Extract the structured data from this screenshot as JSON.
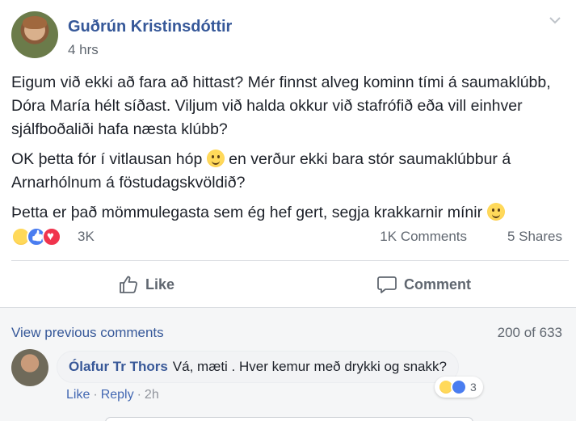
{
  "post": {
    "author": "Guðrún Kristinsdóttir",
    "time": "4 hrs",
    "paragraphs": [
      "Eigum við ekki að fara að hittast? Mér finnst alveg kominn tími á saumaklúbb, Dóra María hélt síðast. Viljum við halda okkur við stafrófið eða vill einhver sjálfboðaliði hafa næsta klúbb?",
      "OK þetta fór í vitlausan hóp",
      "en verður ekki bara stór saumaklúbbur á Arnarhólnum á föstudagskvöldið?",
      "Þetta er það mömmulegasta sem ég hef gert, segja krakkarnir mínir"
    ],
    "icons": {
      "menu": "chevron-down-icon",
      "emoji": "smiley-emoji-icon"
    }
  },
  "reactions": {
    "types": [
      "haha",
      "like",
      "love"
    ],
    "count": "3K",
    "comments": "1K Comments",
    "shares": "5 Shares"
  },
  "actions": {
    "like_label": "Like",
    "comment_label": "Comment"
  },
  "comments": {
    "view_previous": "View previous comments",
    "pager": "200 of 633",
    "items": [
      {
        "author": "Ólafur Tr Thors",
        "text": "Vá, mæti . Hver kemur með drykki og snakk?",
        "reaction_count": "3",
        "like": "Like",
        "reply": "Reply",
        "time": "2h"
      }
    ]
  },
  "colors": {
    "link": "#365899",
    "muted": "#606770",
    "like_blue": "#4a7df0",
    "love_red": "#f0344d"
  }
}
